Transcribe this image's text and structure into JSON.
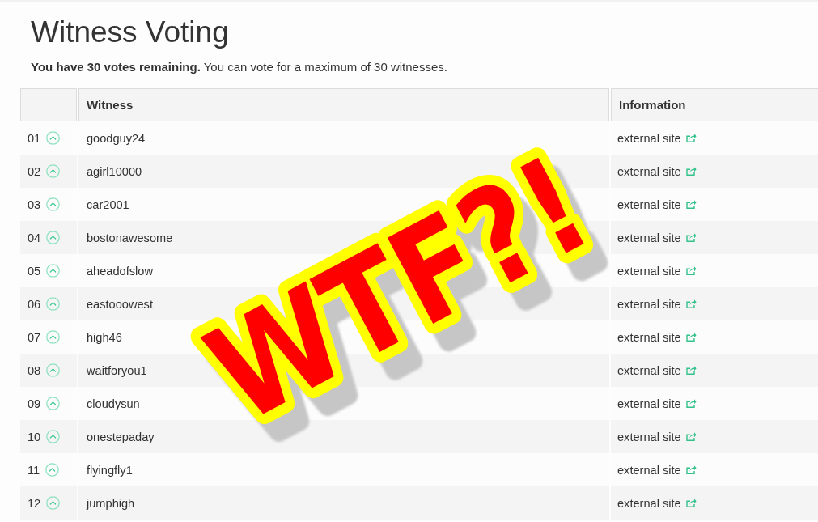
{
  "page": {
    "title": "Witness Voting",
    "summary": "**You have 30 votes remaining.** You can vote for a maximum of 30 witnesses."
  },
  "table": {
    "columns": [
      {
        "label": "Witness"
      },
      {
        "label": "Information"
      }
    ],
    "rows": [
      {
        "rank": "01",
        "witness": "goodguy24",
        "info": "external site"
      },
      {
        "rank": "02",
        "witness": "agirl10000",
        "info": "external site"
      },
      {
        "rank": "03",
        "witness": "car2001",
        "info": "external site"
      },
      {
        "rank": "04",
        "witness": "bostonawesome",
        "info": "external site"
      },
      {
        "rank": "05",
        "witness": "aheadofslow",
        "info": "external site"
      },
      {
        "rank": "06",
        "witness": "eastooowest",
        "info": "external site"
      },
      {
        "rank": "07",
        "witness": "high46",
        "info": "external site"
      },
      {
        "rank": "08",
        "witness": "waitforyou1",
        "info": "external site"
      },
      {
        "rank": "09",
        "witness": "cloudysun",
        "info": "external site"
      },
      {
        "rank": "10",
        "witness": "onestepaday",
        "info": "external site"
      },
      {
        "rank": "11",
        "witness": "flyingfly1",
        "info": "external site"
      },
      {
        "rank": "12",
        "witness": "jumphigh",
        "info": "external site"
      }
    ]
  },
  "overlay": {
    "text": "WTF?!"
  }
}
